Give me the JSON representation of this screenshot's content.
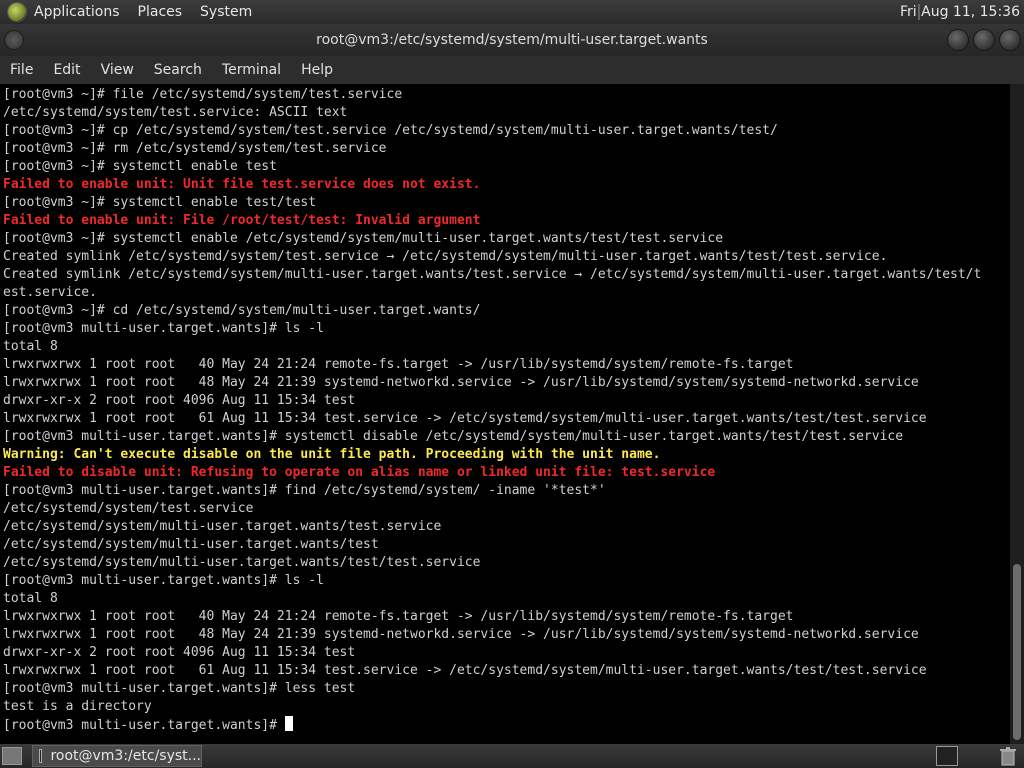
{
  "top_panel": {
    "menus": [
      "Applications",
      "Places",
      "System"
    ],
    "clock": "Fri Aug 11, 15:36"
  },
  "window": {
    "title": "root@vm3:/etc/systemd/system/multi-user.target.wants"
  },
  "menubar": {
    "items": [
      "File",
      "Edit",
      "View",
      "Search",
      "Terminal",
      "Help"
    ]
  },
  "terminal": {
    "lines": [
      {
        "text": "[root@vm3 ~]# file /etc/systemd/system/test.service",
        "style": "normal"
      },
      {
        "text": "/etc/systemd/system/test.service: ASCII text",
        "style": "normal"
      },
      {
        "text": "[root@vm3 ~]# cp /etc/systemd/system/test.service /etc/systemd/system/multi-user.target.wants/test/",
        "style": "normal"
      },
      {
        "text": "[root@vm3 ~]# rm /etc/systemd/system/test.service",
        "style": "normal"
      },
      {
        "text": "[root@vm3 ~]# systemctl enable test",
        "style": "normal"
      },
      {
        "text": "Failed to enable unit: Unit file test.service does not exist.",
        "style": "error"
      },
      {
        "text": "[root@vm3 ~]# systemctl enable test/test",
        "style": "normal"
      },
      {
        "text": "Failed to enable unit: File /root/test/test: Invalid argument",
        "style": "error"
      },
      {
        "text": "[root@vm3 ~]# systemctl enable /etc/systemd/system/multi-user.target.wants/test/test.service",
        "style": "normal"
      },
      {
        "text": "Created symlink /etc/systemd/system/test.service → /etc/systemd/system/multi-user.target.wants/test/test.service.",
        "style": "normal"
      },
      {
        "text": "Created symlink /etc/systemd/system/multi-user.target.wants/test.service → /etc/systemd/system/multi-user.target.wants/test/t",
        "style": "normal"
      },
      {
        "text": "est.service.",
        "style": "normal"
      },
      {
        "text": "[root@vm3 ~]# cd /etc/systemd/system/multi-user.target.wants/",
        "style": "normal"
      },
      {
        "text": "[root@vm3 multi-user.target.wants]# ls -l",
        "style": "normal"
      },
      {
        "text": "total 8",
        "style": "normal"
      },
      {
        "text": "lrwxrwxrwx 1 root root   40 May 24 21:24 remote-fs.target -> /usr/lib/systemd/system/remote-fs.target",
        "style": "normal"
      },
      {
        "text": "lrwxrwxrwx 1 root root   48 May 24 21:39 systemd-networkd.service -> /usr/lib/systemd/system/systemd-networkd.service",
        "style": "normal"
      },
      {
        "text": "drwxr-xr-x 2 root root 4096 Aug 11 15:34 test",
        "style": "normal"
      },
      {
        "text": "lrwxrwxrwx 1 root root   61 Aug 11 15:34 test.service -> /etc/systemd/system/multi-user.target.wants/test/test.service",
        "style": "normal"
      },
      {
        "text": "[root@vm3 multi-user.target.wants]# systemctl disable /etc/systemd/system/multi-user.target.wants/test/test.service",
        "style": "normal"
      },
      {
        "text": "Warning: Can't execute disable on the unit file path. Proceeding with the unit name.",
        "style": "warning"
      },
      {
        "text": "Failed to disable unit: Refusing to operate on alias name or linked unit file: test.service",
        "style": "error"
      },
      {
        "text": "[root@vm3 multi-user.target.wants]# find /etc/systemd/system/ -iname '*test*'",
        "style": "normal"
      },
      {
        "text": "/etc/systemd/system/test.service",
        "style": "normal"
      },
      {
        "text": "/etc/systemd/system/multi-user.target.wants/test.service",
        "style": "normal"
      },
      {
        "text": "/etc/systemd/system/multi-user.target.wants/test",
        "style": "normal"
      },
      {
        "text": "/etc/systemd/system/multi-user.target.wants/test/test.service",
        "style": "normal"
      },
      {
        "text": "[root@vm3 multi-user.target.wants]# ls -l",
        "style": "normal"
      },
      {
        "text": "total 8",
        "style": "normal"
      },
      {
        "text": "lrwxrwxrwx 1 root root   40 May 24 21:24 remote-fs.target -> /usr/lib/systemd/system/remote-fs.target",
        "style": "normal"
      },
      {
        "text": "lrwxrwxrwx 1 root root   48 May 24 21:39 systemd-networkd.service -> /usr/lib/systemd/system/systemd-networkd.service",
        "style": "normal"
      },
      {
        "text": "drwxr-xr-x 2 root root 4096 Aug 11 15:34 test",
        "style": "normal"
      },
      {
        "text": "lrwxrwxrwx 1 root root   61 Aug 11 15:34 test.service -> /etc/systemd/system/multi-user.target.wants/test/test.service",
        "style": "normal"
      },
      {
        "text": "[root@vm3 multi-user.target.wants]# less test",
        "style": "normal"
      },
      {
        "text": "test is a directory",
        "style": "normal"
      }
    ],
    "prompt": "[root@vm3 multi-user.target.wants]# "
  },
  "taskbar": {
    "task_label": "root@vm3:/etc/syst..."
  },
  "colors": {
    "error": "#ef2929",
    "warning": "#fce94f",
    "terminal_bg": "#000000",
    "terminal_fg": "#d0d0d0"
  }
}
